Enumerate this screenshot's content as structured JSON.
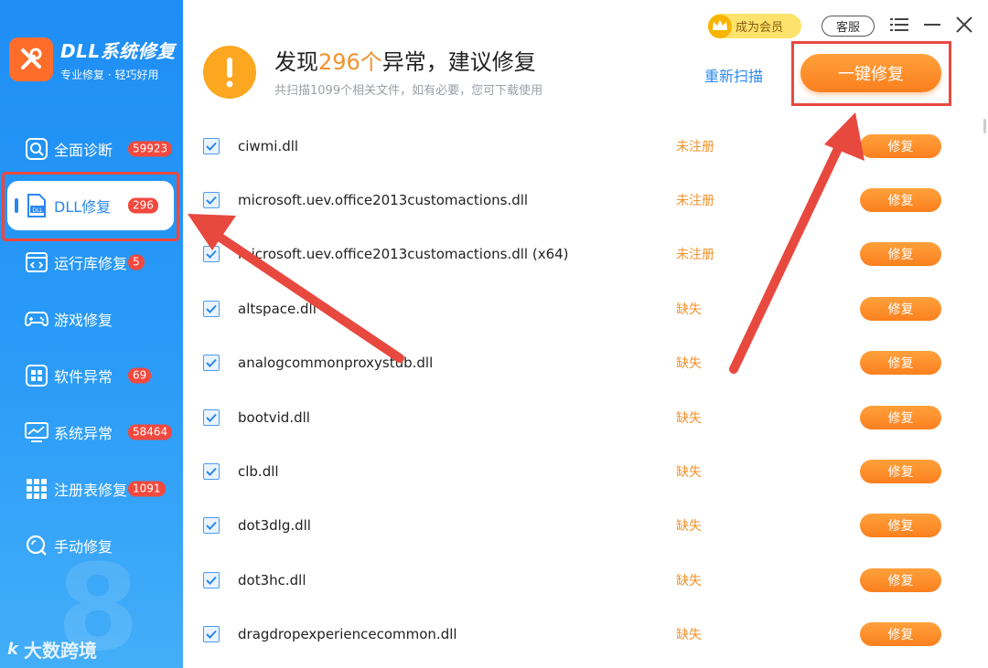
{
  "brand": {
    "title": "DLL系统修复",
    "subtitle": "专业修复 · 轻巧好用"
  },
  "sidebar": {
    "items": [
      {
        "label": "全面诊断",
        "badge": "59923",
        "icon": "search-icon"
      },
      {
        "label": "DLL修复",
        "badge": "296",
        "icon": "dll-file-icon",
        "active": true
      },
      {
        "label": "运行库修复",
        "badge": "5",
        "icon": "code-window-icon"
      },
      {
        "label": "游戏修复",
        "badge": "",
        "icon": "gamepad-icon"
      },
      {
        "label": "软件异常",
        "badge": "69",
        "icon": "app-grid-icon"
      },
      {
        "label": "系统异常",
        "badge": "58464",
        "icon": "monitor-chart-icon"
      },
      {
        "label": "注册表修复",
        "badge": "1091",
        "icon": "registry-grid-icon"
      },
      {
        "label": "手动修复",
        "badge": "",
        "icon": "manual-search-icon"
      }
    ],
    "watermark": "大数跨境",
    "watermark_mark": "k"
  },
  "topbar": {
    "vip_label": "成为会员",
    "service_label": "客服"
  },
  "header": {
    "title_prefix": "发现",
    "title_count": "296个",
    "title_suffix": "异常，建议修复",
    "subtitle": "共扫描1099个相关文件，如有必要，您可下载使用",
    "rescan_label": "重新扫描",
    "fix_all_label": "一键修复"
  },
  "list": {
    "fix_label": "修复",
    "rows": [
      {
        "name": "ciwmi.dll",
        "status": "未注册",
        "checked": true
      },
      {
        "name": "microsoft.uev.office2013customactions.dll",
        "status": "未注册",
        "checked": true
      },
      {
        "name": "microsoft.uev.office2013customactions.dll (x64)",
        "status": "未注册",
        "checked": true
      },
      {
        "name": "altspace.dll",
        "status": "缺失",
        "checked": true
      },
      {
        "name": "analogcommonproxystub.dll",
        "status": "缺失",
        "checked": true
      },
      {
        "name": "bootvid.dll",
        "status": "缺失",
        "checked": true
      },
      {
        "name": "clb.dll",
        "status": "缺失",
        "checked": true
      },
      {
        "name": "dot3dlg.dll",
        "status": "缺失",
        "checked": true
      },
      {
        "name": "dot3hc.dll",
        "status": "缺失",
        "checked": true
      },
      {
        "name": "dragdropexperiencecommon.dll",
        "status": "缺失",
        "checked": true
      }
    ]
  },
  "colors": {
    "sidebar_blue": "#1e8ef5",
    "accent_orange": "#fb8a22",
    "status_orange": "#f2922c",
    "badge_red": "#f2493f",
    "annotation_red": "#e8493f"
  }
}
